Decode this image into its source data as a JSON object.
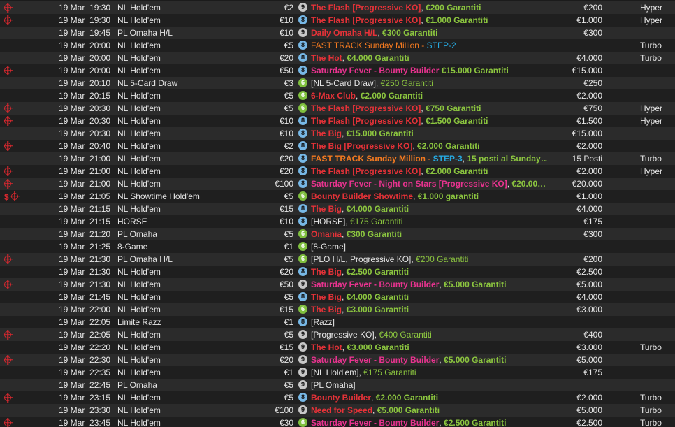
{
  "colors": {
    "red": "#e53238",
    "pink": "#e8338f",
    "green": "#8cc63f",
    "orange": "#f47a20",
    "blue": "#26a9e0",
    "white": "#e6e6e6",
    "knockout_icon": "#d7282f",
    "row_even": "#2b2b2b",
    "row_odd": "#1f1f1f"
  },
  "icon_names": {
    "knockout": "knockout-target-icon",
    "bounty": "dollar-bounty-icon",
    "seats": "seats-badge-icon"
  },
  "rows": [
    {
      "icons": [
        "ko"
      ],
      "date": "19 Mar",
      "time": "19:30",
      "game": "NL Hold'em",
      "buyin": "€2",
      "seats": "9",
      "name": [
        {
          "t": "The Flash [Progressive KO]",
          "c": "red"
        },
        {
          "t": ", ",
          "c": "white"
        },
        {
          "t": "€200 Garantiti",
          "c": "green"
        }
      ],
      "prize": "€200",
      "speed": "Hyper"
    },
    {
      "icons": [
        "ko"
      ],
      "date": "19 Mar",
      "time": "19:30",
      "game": "NL Hold'em",
      "buyin": "€10",
      "seats": "8",
      "name": [
        {
          "t": "The Flash [Progressive KO]",
          "c": "red"
        },
        {
          "t": ", ",
          "c": "white"
        },
        {
          "t": "€1.000 Garantiti",
          "c": "green"
        }
      ],
      "prize": "€1.000",
      "speed": "Hyper"
    },
    {
      "icons": [],
      "date": "19 Mar",
      "time": "19:45",
      "game": "PL Omaha H/L",
      "buyin": "€10",
      "seats": "9",
      "name": [
        {
          "t": "Daily Omaha H/L",
          "c": "red"
        },
        {
          "t": ", ",
          "c": "white"
        },
        {
          "t": "€300 Garantiti",
          "c": "green"
        }
      ],
      "prize": "€300",
      "speed": ""
    },
    {
      "icons": [],
      "date": "19 Mar",
      "time": "20:00",
      "game": "NL Hold'em",
      "buyin": "€5",
      "seats": "8",
      "name": [
        {
          "t": "FAST TRACK Sunday Million - ",
          "c": "orangen"
        },
        {
          "t": "STEP-2",
          "c": "bluen"
        }
      ],
      "prize": "",
      "speed": "Turbo"
    },
    {
      "icons": [],
      "date": "19 Mar",
      "time": "20:00",
      "game": "NL Hold'em",
      "buyin": "€20",
      "seats": "8",
      "name": [
        {
          "t": "The Hot",
          "c": "red"
        },
        {
          "t": ", ",
          "c": "white"
        },
        {
          "t": "€4.000 Garantiti",
          "c": "green"
        }
      ],
      "prize": "€4.000",
      "speed": "Turbo"
    },
    {
      "icons": [
        "ko"
      ],
      "date": "19 Mar",
      "time": "20:00",
      "game": "NL Hold'em",
      "buyin": "€50",
      "seats": "8",
      "name": [
        {
          "t": "Saturday Fever - Bounty Builder",
          "c": "pink"
        },
        {
          "t": " ",
          "c": "white"
        },
        {
          "t": "€15.000 Garantiti",
          "c": "green"
        }
      ],
      "prize": "€15.000",
      "speed": ""
    },
    {
      "icons": [],
      "date": "19 Mar",
      "time": "20:10",
      "game": "NL 5-Card Draw",
      "buyin": "€3",
      "seats": "6",
      "name": [
        {
          "t": "[NL 5-Card Draw]",
          "c": "white"
        },
        {
          "t": ", ",
          "c": "white"
        },
        {
          "t": "€250 Garantiti",
          "c": "greenn"
        }
      ],
      "prize": "€250",
      "speed": ""
    },
    {
      "icons": [],
      "date": "19 Mar",
      "time": "20:15",
      "game": "NL Hold'em",
      "buyin": "€5",
      "seats": "6",
      "name": [
        {
          "t": "6-Max Club",
          "c": "red"
        },
        {
          "t": ", ",
          "c": "white"
        },
        {
          "t": "€2.000 Garantiti",
          "c": "green"
        }
      ],
      "prize": "€2.000",
      "speed": ""
    },
    {
      "icons": [
        "ko"
      ],
      "date": "19 Mar",
      "time": "20:30",
      "game": "NL Hold'em",
      "buyin": "€5",
      "seats": "6",
      "name": [
        {
          "t": "The Flash [Progressive KO]",
          "c": "red"
        },
        {
          "t": ", ",
          "c": "white"
        },
        {
          "t": "€750 Garantiti",
          "c": "green"
        }
      ],
      "prize": "€750",
      "speed": "Hyper"
    },
    {
      "icons": [
        "ko"
      ],
      "date": "19 Mar",
      "time": "20:30",
      "game": "NL Hold'em",
      "buyin": "€10",
      "seats": "8",
      "name": [
        {
          "t": "The Flash [Progressive KO]",
          "c": "red"
        },
        {
          "t": ", ",
          "c": "white"
        },
        {
          "t": "€1.500 Garantiti",
          "c": "green"
        }
      ],
      "prize": "€1.500",
      "speed": "Hyper"
    },
    {
      "icons": [],
      "date": "19 Mar",
      "time": "20:30",
      "game": "NL Hold'em",
      "buyin": "€10",
      "seats": "8",
      "name": [
        {
          "t": "The Big",
          "c": "red"
        },
        {
          "t": ", ",
          "c": "white"
        },
        {
          "t": "€15.000 Garantiti",
          "c": "green"
        }
      ],
      "prize": "€15.000",
      "speed": ""
    },
    {
      "icons": [
        "ko"
      ],
      "date": "19 Mar",
      "time": "20:40",
      "game": "NL Hold'em",
      "buyin": "€2",
      "seats": "8",
      "name": [
        {
          "t": "The Big [Progressive KO]",
          "c": "red"
        },
        {
          "t": ", ",
          "c": "white"
        },
        {
          "t": "€2.000 Garantiti",
          "c": "green"
        }
      ],
      "prize": "€2.000",
      "speed": ""
    },
    {
      "icons": [],
      "date": "19 Mar",
      "time": "21:00",
      "game": "NL Hold'em",
      "buyin": "€20",
      "seats": "8",
      "name": [
        {
          "t": "FAST TRACK Sunday Million - ",
          "c": "orange"
        },
        {
          "t": "STEP-3",
          "c": "blue"
        },
        {
          "t": ", ",
          "c": "white"
        },
        {
          "t": "15 posti al Sunday…",
          "c": "green"
        }
      ],
      "prize": "15 Posti",
      "speed": "Turbo"
    },
    {
      "icons": [
        "ko"
      ],
      "date": "19 Mar",
      "time": "21:00",
      "game": "NL Hold'em",
      "buyin": "€20",
      "seats": "8",
      "name": [
        {
          "t": "The Flash [Progressive KO]",
          "c": "red"
        },
        {
          "t": ", ",
          "c": "white"
        },
        {
          "t": "€2.000 Garantiti",
          "c": "green"
        }
      ],
      "prize": "€2.000",
      "speed": "Hyper"
    },
    {
      "icons": [
        "ko"
      ],
      "date": "19 Mar",
      "time": "21:00",
      "game": "NL Hold'em",
      "buyin": "€100",
      "seats": "8",
      "name": [
        {
          "t": "Saturday Fever - Night on Stars [Progressive KO]",
          "c": "pink"
        },
        {
          "t": ", ",
          "c": "white"
        },
        {
          "t": "€20.00…",
          "c": "green"
        }
      ],
      "prize": "€20.000",
      "speed": ""
    },
    {
      "icons": [
        "bounty",
        "ko"
      ],
      "date": "19 Mar",
      "time": "21:05",
      "game": "NL Showtime Hold'em",
      "buyin": "€5",
      "seats": "6",
      "name": [
        {
          "t": "Bounty Builder Showtime",
          "c": "red"
        },
        {
          "t": ", ",
          "c": "white"
        },
        {
          "t": "€1.000 garantiti",
          "c": "green"
        }
      ],
      "prize": "€1.000",
      "speed": ""
    },
    {
      "icons": [],
      "date": "19 Mar",
      "time": "21:15",
      "game": "NL Hold'em",
      "buyin": "€15",
      "seats": "8",
      "name": [
        {
          "t": "The Big",
          "c": "red"
        },
        {
          "t": ", ",
          "c": "white"
        },
        {
          "t": "€4.000 Garantiti",
          "c": "green"
        }
      ],
      "prize": "€4.000",
      "speed": ""
    },
    {
      "icons": [],
      "date": "19 Mar",
      "time": "21:15",
      "game": "HORSE",
      "buyin": "€10",
      "seats": "8",
      "name": [
        {
          "t": "[HORSE]",
          "c": "white"
        },
        {
          "t": ", ",
          "c": "white"
        },
        {
          "t": "€175 Garantiti",
          "c": "greenn"
        }
      ],
      "prize": "€175",
      "speed": ""
    },
    {
      "icons": [],
      "date": "19 Mar",
      "time": "21:20",
      "game": "PL Omaha",
      "buyin": "€5",
      "seats": "6",
      "name": [
        {
          "t": "Omania",
          "c": "red"
        },
        {
          "t": ", ",
          "c": "white"
        },
        {
          "t": "€300 Garantiti",
          "c": "green"
        }
      ],
      "prize": "€300",
      "speed": ""
    },
    {
      "icons": [],
      "date": "19 Mar",
      "time": "21:25",
      "game": "8-Game",
      "buyin": "€1",
      "seats": "6",
      "name": [
        {
          "t": "[8-Game]",
          "c": "white"
        }
      ],
      "prize": "",
      "speed": ""
    },
    {
      "icons": [
        "ko"
      ],
      "date": "19 Mar",
      "time": "21:30",
      "game": "PL Omaha H/L",
      "buyin": "€5",
      "seats": "6",
      "name": [
        {
          "t": "[PLO H/L, Progressive KO]",
          "c": "white"
        },
        {
          "t": ", ",
          "c": "white"
        },
        {
          "t": "€200 Garantiti",
          "c": "greenn"
        }
      ],
      "prize": "€200",
      "speed": ""
    },
    {
      "icons": [],
      "date": "19 Mar",
      "time": "21:30",
      "game": "NL Hold'em",
      "buyin": "€20",
      "seats": "8",
      "name": [
        {
          "t": "The Big",
          "c": "red"
        },
        {
          "t": ", ",
          "c": "white"
        },
        {
          "t": "€2.500 Garantiti",
          "c": "green"
        }
      ],
      "prize": "€2.500",
      "speed": ""
    },
    {
      "icons": [
        "ko"
      ],
      "date": "19 Mar",
      "time": "21:30",
      "game": "NL Hold'em",
      "buyin": "€50",
      "seats": "9",
      "name": [
        {
          "t": "Saturday Fever - Bounty Builder",
          "c": "pink"
        },
        {
          "t": ", ",
          "c": "white"
        },
        {
          "t": "€5.000 Garantiti",
          "c": "green"
        }
      ],
      "prize": "€5.000",
      "speed": ""
    },
    {
      "icons": [],
      "date": "19 Mar",
      "time": "21:45",
      "game": "NL Hold'em",
      "buyin": "€5",
      "seats": "8",
      "name": [
        {
          "t": "The Big",
          "c": "red"
        },
        {
          "t": ", ",
          "c": "white"
        },
        {
          "t": "€4.000 Garantiti",
          "c": "green"
        }
      ],
      "prize": "€4.000",
      "speed": ""
    },
    {
      "icons": [],
      "date": "19 Mar",
      "time": "22:00",
      "game": "NL Hold'em",
      "buyin": "€15",
      "seats": "6",
      "name": [
        {
          "t": "The Big",
          "c": "red"
        },
        {
          "t": ", ",
          "c": "white"
        },
        {
          "t": "€3.000 Garantiti",
          "c": "green"
        }
      ],
      "prize": "€3.000",
      "speed": ""
    },
    {
      "icons": [],
      "date": "19 Mar",
      "time": "22:05",
      "game": "Limite Razz",
      "buyin": "€1",
      "seats": "8",
      "name": [
        {
          "t": "[Razz]",
          "c": "white"
        }
      ],
      "prize": "",
      "speed": ""
    },
    {
      "icons": [
        "ko"
      ],
      "date": "19 Mar",
      "time": "22:05",
      "game": "NL Hold'em",
      "buyin": "€5",
      "seats": "9",
      "name": [
        {
          "t": "[Progressive KO]",
          "c": "white"
        },
        {
          "t": ", ",
          "c": "white"
        },
        {
          "t": "€400 Garantiti",
          "c": "greenn"
        }
      ],
      "prize": "€400",
      "speed": ""
    },
    {
      "icons": [],
      "date": "19 Mar",
      "time": "22:20",
      "game": "NL Hold'em",
      "buyin": "€15",
      "seats": "9",
      "name": [
        {
          "t": "The Hot",
          "c": "red"
        },
        {
          "t": ", ",
          "c": "white"
        },
        {
          "t": "€3.000 Garantiti",
          "c": "green"
        }
      ],
      "prize": "€3.000",
      "speed": "Turbo"
    },
    {
      "icons": [
        "ko"
      ],
      "date": "19 Mar",
      "time": "22:30",
      "game": "NL Hold'em",
      "buyin": "€20",
      "seats": "9",
      "name": [
        {
          "t": "Saturday Fever - Bounty Builder",
          "c": "pink"
        },
        {
          "t": ", ",
          "c": "white"
        },
        {
          "t": "€5.000 Garantiti",
          "c": "green"
        }
      ],
      "prize": "€5.000",
      "speed": ""
    },
    {
      "icons": [],
      "date": "19 Mar",
      "time": "22:35",
      "game": "NL Hold'em",
      "buyin": "€1",
      "seats": "9",
      "name": [
        {
          "t": "[NL Hold'em]",
          "c": "white"
        },
        {
          "t": ", ",
          "c": "white"
        },
        {
          "t": "€175 Garantiti",
          "c": "greenn"
        }
      ],
      "prize": "€175",
      "speed": ""
    },
    {
      "icons": [],
      "date": "19 Mar",
      "time": "22:45",
      "game": "PL Omaha",
      "buyin": "€5",
      "seats": "9",
      "name": [
        {
          "t": "[PL Omaha]",
          "c": "white"
        }
      ],
      "prize": "",
      "speed": ""
    },
    {
      "icons": [
        "ko"
      ],
      "date": "19 Mar",
      "time": "23:15",
      "game": "NL Hold'em",
      "buyin": "€5",
      "seats": "8",
      "name": [
        {
          "t": "Bounty Builder",
          "c": "red"
        },
        {
          "t": ", ",
          "c": "white"
        },
        {
          "t": "€2.000 Garantiti",
          "c": "green"
        }
      ],
      "prize": "€2.000",
      "speed": "Turbo"
    },
    {
      "icons": [],
      "date": "19 Mar",
      "time": "23:30",
      "game": "NL Hold'em",
      "buyin": "€100",
      "seats": "9",
      "name": [
        {
          "t": "Need for Speed",
          "c": "red"
        },
        {
          "t": ", ",
          "c": "white"
        },
        {
          "t": "€5.000 Garantiti",
          "c": "green"
        }
      ],
      "prize": "€5.000",
      "speed": "Turbo"
    },
    {
      "icons": [
        "ko"
      ],
      "date": "19 Mar",
      "time": "23:45",
      "game": "NL Hold'em",
      "buyin": "€30",
      "seats": "6",
      "name": [
        {
          "t": "Saturday Fever - Bounty Builder",
          "c": "pink"
        },
        {
          "t": ", ",
          "c": "white"
        },
        {
          "t": "€2.500 Garantiti",
          "c": "green"
        }
      ],
      "prize": "€2.500",
      "speed": "Turbo"
    }
  ]
}
